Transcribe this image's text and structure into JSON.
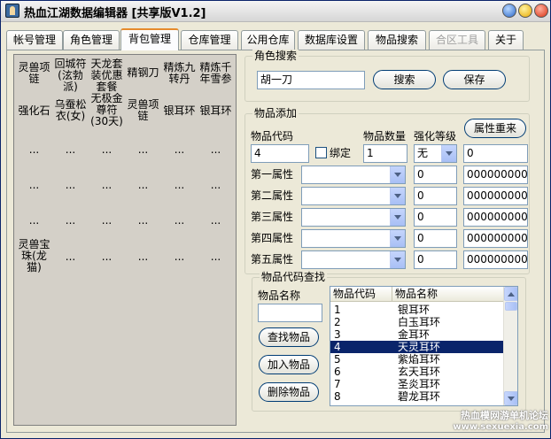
{
  "window": {
    "title": "热血江湖数据编辑器 [共享版V1.2]"
  },
  "tabs": [
    {
      "label": "帐号管理"
    },
    {
      "label": "角色管理"
    },
    {
      "label": "背包管理"
    },
    {
      "label": "仓库管理"
    },
    {
      "label": "公用仓库"
    },
    {
      "label": "数据库设置"
    },
    {
      "label": "物品搜索"
    },
    {
      "label": "合区工具"
    },
    {
      "label": "关于"
    }
  ],
  "inventory_grid": [
    [
      "灵兽项链",
      "回城符(泫勃派)",
      "天龙套装优惠套餐",
      "精钢刀",
      "精炼九转丹",
      "精炼千年雪参"
    ],
    [
      "强化石",
      "乌蚕松衣(女)",
      "无极金尊符(30天)",
      "灵兽项链",
      "银耳环",
      "银耳环"
    ],
    [
      "...",
      "...",
      "...",
      "...",
      "...",
      "..."
    ],
    [
      "...",
      "...",
      "...",
      "...",
      "...",
      "..."
    ],
    [
      "...",
      "...",
      "...",
      "...",
      "...",
      "..."
    ],
    [
      "灵兽宝珠(龙猫)",
      "...",
      "...",
      "...",
      "...",
      "..."
    ]
  ],
  "role_search": {
    "title": "角色搜索",
    "value": "胡一刀",
    "search_label": "搜索",
    "save_label": "保存"
  },
  "item_add": {
    "title": "物品添加",
    "code_label": "物品代码",
    "qty_label": "物品数量",
    "enhance_label": "强化等级",
    "reset_attr_label": "属性重来",
    "code_value": "4",
    "bind_label": "绑定",
    "qty_value": "1",
    "enhance_value": "无",
    "extra_value": "0",
    "attrs": [
      {
        "label": "第一属性",
        "val": "0",
        "code": "0000000000"
      },
      {
        "label": "第二属性",
        "val": "0",
        "code": "0000000000"
      },
      {
        "label": "第三属性",
        "val": "0",
        "code": "0000000000"
      },
      {
        "label": "第四属性",
        "val": "0",
        "code": "0000000000"
      },
      {
        "label": "第五属性",
        "val": "0",
        "code": "0000000000"
      }
    ]
  },
  "item_lookup": {
    "title": "物品代码查找",
    "name_label": "物品名称",
    "name_value": "",
    "find_label": "查找物品",
    "add_label": "加入物品",
    "delete_label": "删除物品",
    "columns": [
      "物品代码",
      "物品名称"
    ],
    "rows": [
      {
        "code": "1",
        "name": "银耳环"
      },
      {
        "code": "2",
        "name": "白玉耳环"
      },
      {
        "code": "3",
        "name": "金耳环"
      },
      {
        "code": "4",
        "name": "天灵耳环"
      },
      {
        "code": "5",
        "name": "紫焰耳环"
      },
      {
        "code": "6",
        "name": "玄天耳环"
      },
      {
        "code": "7",
        "name": "圣炎耳环"
      },
      {
        "code": "8",
        "name": "碧龙耳环"
      }
    ],
    "selected_index": 3
  },
  "watermark": {
    "line1": "热血模网游单机论坛",
    "line2": "www.sexuexia.com"
  }
}
